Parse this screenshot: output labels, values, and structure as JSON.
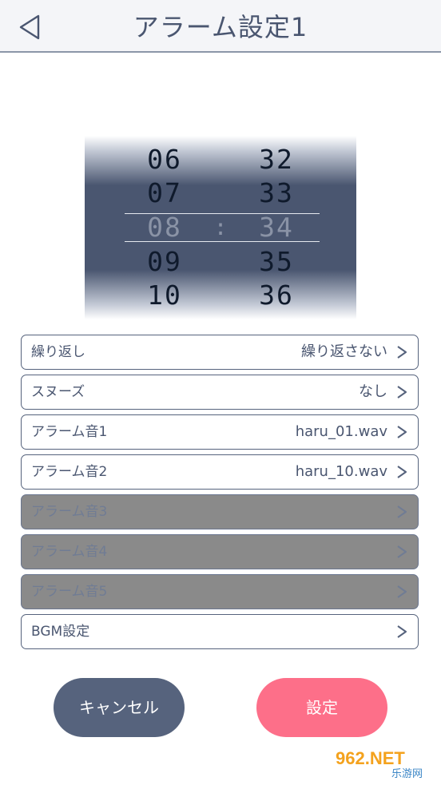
{
  "header": {
    "title": "アラーム設定1"
  },
  "picker": {
    "hours": [
      "06",
      "07",
      "08",
      "09",
      "10"
    ],
    "minutes": [
      "32",
      "33",
      "34",
      "35",
      "36"
    ],
    "separator": ":",
    "selected_hour": "08",
    "selected_minute": "34"
  },
  "settings": [
    {
      "label": "繰り返し",
      "value": "繰り返さない",
      "enabled": true
    },
    {
      "label": "スヌーズ",
      "value": "なし",
      "enabled": true
    },
    {
      "label": "アラーム音1",
      "value": "haru_01.wav",
      "enabled": true
    },
    {
      "label": "アラーム音2",
      "value": "haru_10.wav",
      "enabled": true
    },
    {
      "label": "アラーム音3",
      "value": "",
      "enabled": false
    },
    {
      "label": "アラーム音4",
      "value": "",
      "enabled": false
    },
    {
      "label": "アラーム音5",
      "value": "",
      "enabled": false
    },
    {
      "label": "BGM設定",
      "value": "",
      "enabled": true
    }
  ],
  "buttons": {
    "cancel": "キャンセル",
    "set": "設定"
  },
  "watermark": {
    "text": "962.NET",
    "subtext": "乐游网"
  },
  "colors": {
    "primary": "#56637d",
    "accent": "#fd6f89",
    "disabled": "#8a8a8a",
    "header_bg": "#f4f5f8"
  }
}
